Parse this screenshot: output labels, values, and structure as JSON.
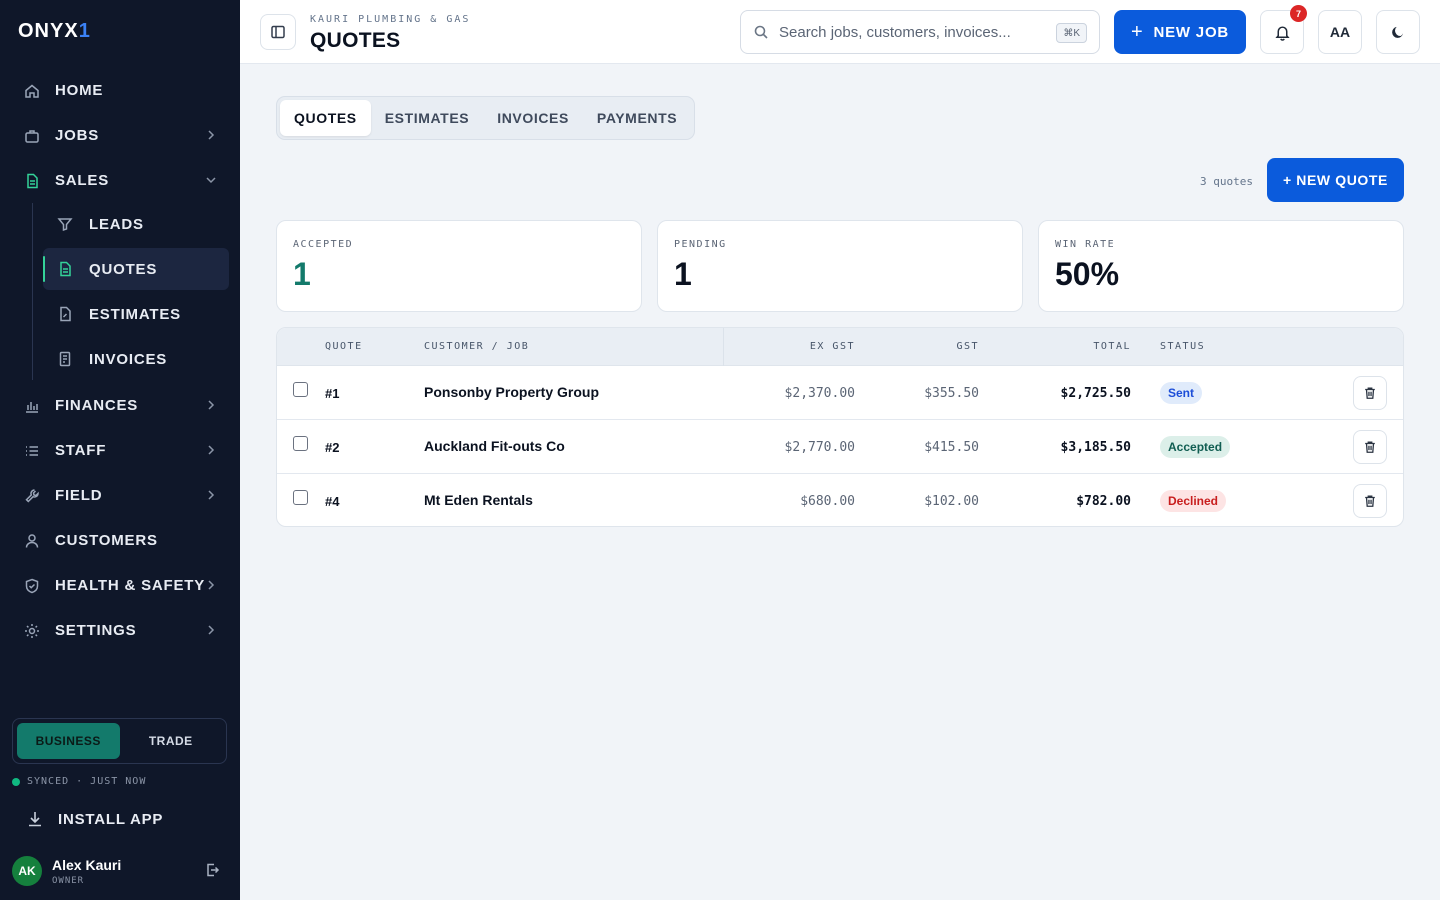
{
  "brand": {
    "name": "ONYX",
    "accent": "1"
  },
  "sidebar": {
    "items": [
      {
        "label": "HOME",
        "icon": "home-icon"
      },
      {
        "label": "JOBS",
        "icon": "briefcase-icon"
      },
      {
        "label": "SALES",
        "icon": "document-icon"
      },
      {
        "label": "FINANCES",
        "icon": "bar-chart-icon"
      },
      {
        "label": "STAFF",
        "icon": "list-icon"
      },
      {
        "label": "FIELD",
        "icon": "wrench-icon"
      },
      {
        "label": "CUSTOMERS",
        "icon": "user-icon"
      },
      {
        "label": "HEALTH & SAFETY",
        "icon": "shield-icon"
      },
      {
        "label": "SETTINGS",
        "icon": "gear-icon"
      }
    ],
    "sales_sub": [
      {
        "label": "LEADS",
        "icon": "filter-icon"
      },
      {
        "label": "QUOTES",
        "icon": "document-icon"
      },
      {
        "label": "ESTIMATES",
        "icon": "calculator-icon"
      },
      {
        "label": "INVOICES",
        "icon": "receipt-icon"
      }
    ],
    "mode": {
      "business": "BUSINESS",
      "trade": "TRADE"
    },
    "sync_status": "SYNCED · JUST NOW",
    "install_label": "INSTALL APP",
    "user": {
      "initials": "AK",
      "name": "Alex Kauri",
      "role": "OWNER"
    }
  },
  "header": {
    "company": "KAURI PLUMBING & GAS",
    "title": "QUOTES",
    "search_placeholder": "Search jobs, customers, invoices...",
    "search_shortcut": "⌘K",
    "new_job_label": "NEW JOB",
    "notification_count": "7",
    "font_size_label": "AA"
  },
  "tabs": [
    "QUOTES",
    "ESTIMATES",
    "INVOICES",
    "PAYMENTS"
  ],
  "summary": {
    "count_text": "3 quotes",
    "new_quote_label": "+ NEW QUOTE",
    "stats": [
      {
        "label": "ACCEPTED",
        "value": "1"
      },
      {
        "label": "PENDING",
        "value": "1"
      },
      {
        "label": "WIN RATE",
        "value": "50%"
      }
    ]
  },
  "table": {
    "columns": {
      "quote": "QUOTE",
      "customer": "CUSTOMER / JOB",
      "ex_gst": "EX GST",
      "gst": "GST",
      "total": "TOTAL",
      "status": "STATUS"
    },
    "rows": [
      {
        "quote": "#1",
        "customer": "Ponsonby Property Group",
        "ex_gst": "$2,370.00",
        "gst": "$355.50",
        "total": "$2,725.50",
        "status": "Sent"
      },
      {
        "quote": "#2",
        "customer": "Auckland Fit-outs Co",
        "ex_gst": "$2,770.00",
        "gst": "$415.50",
        "total": "$3,185.50",
        "status": "Accepted"
      },
      {
        "quote": "#4",
        "customer": "Mt Eden Rentals",
        "ex_gst": "$680.00",
        "gst": "$102.00",
        "total": "$782.00",
        "status": "Declined"
      }
    ]
  },
  "colors": {
    "sidebar_bg": "#0f1729",
    "primary": "#0b5bdc",
    "accent_green": "#137a6b",
    "sync_green": "#10b981"
  }
}
